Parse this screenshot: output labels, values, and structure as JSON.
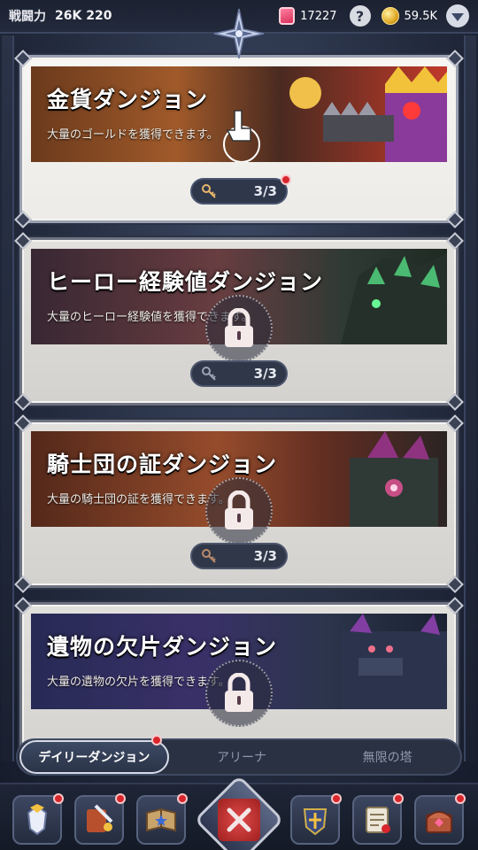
{
  "header": {
    "power_label": "戦闘力",
    "power_value": "26K 220",
    "gems": "17227",
    "help_label": "?",
    "coins": "59.5K"
  },
  "dungeons": [
    {
      "title": "金貨ダンジョン",
      "desc": "大量のゴールドを獲得できます。",
      "keys": "3/3",
      "locked": false,
      "has_alert": true
    },
    {
      "title": "ヒーロー経験値ダンジョン",
      "desc": "大量のヒーロー経験値を獲得できます。",
      "keys": "3/3",
      "locked": true,
      "has_alert": false
    },
    {
      "title": "騎士団の証ダンジョン",
      "desc": "大量の騎士団の証を獲得できます。",
      "keys": "3/3",
      "locked": true,
      "has_alert": false
    },
    {
      "title": "遺物の欠片ダンジョン",
      "desc": "大量の遺物の欠片を獲得できます。",
      "keys": "3/3",
      "locked": true,
      "has_alert": false
    }
  ],
  "tabs": [
    {
      "label": "デイリーダンジョン",
      "active": true,
      "alert": true
    },
    {
      "label": "アリーナ",
      "active": false,
      "alert": false
    },
    {
      "label": "無限の塔",
      "active": false,
      "alert": false
    }
  ],
  "bottom_nav": [
    {
      "icon": "hero-icon",
      "alert": true
    },
    {
      "icon": "equipment-icon",
      "alert": true
    },
    {
      "icon": "book-icon",
      "alert": true
    },
    {
      "icon": "close-icon",
      "alert": false
    },
    {
      "icon": "guild-icon",
      "alert": true
    },
    {
      "icon": "quest-scroll-icon",
      "alert": true
    },
    {
      "icon": "shop-chest-icon",
      "alert": true
    }
  ],
  "colors": {
    "alert_red": "#d8262c",
    "gem_pink": "#d8305b",
    "coin_gold": "#e0a825",
    "panel_bg": "#ecebe7"
  }
}
